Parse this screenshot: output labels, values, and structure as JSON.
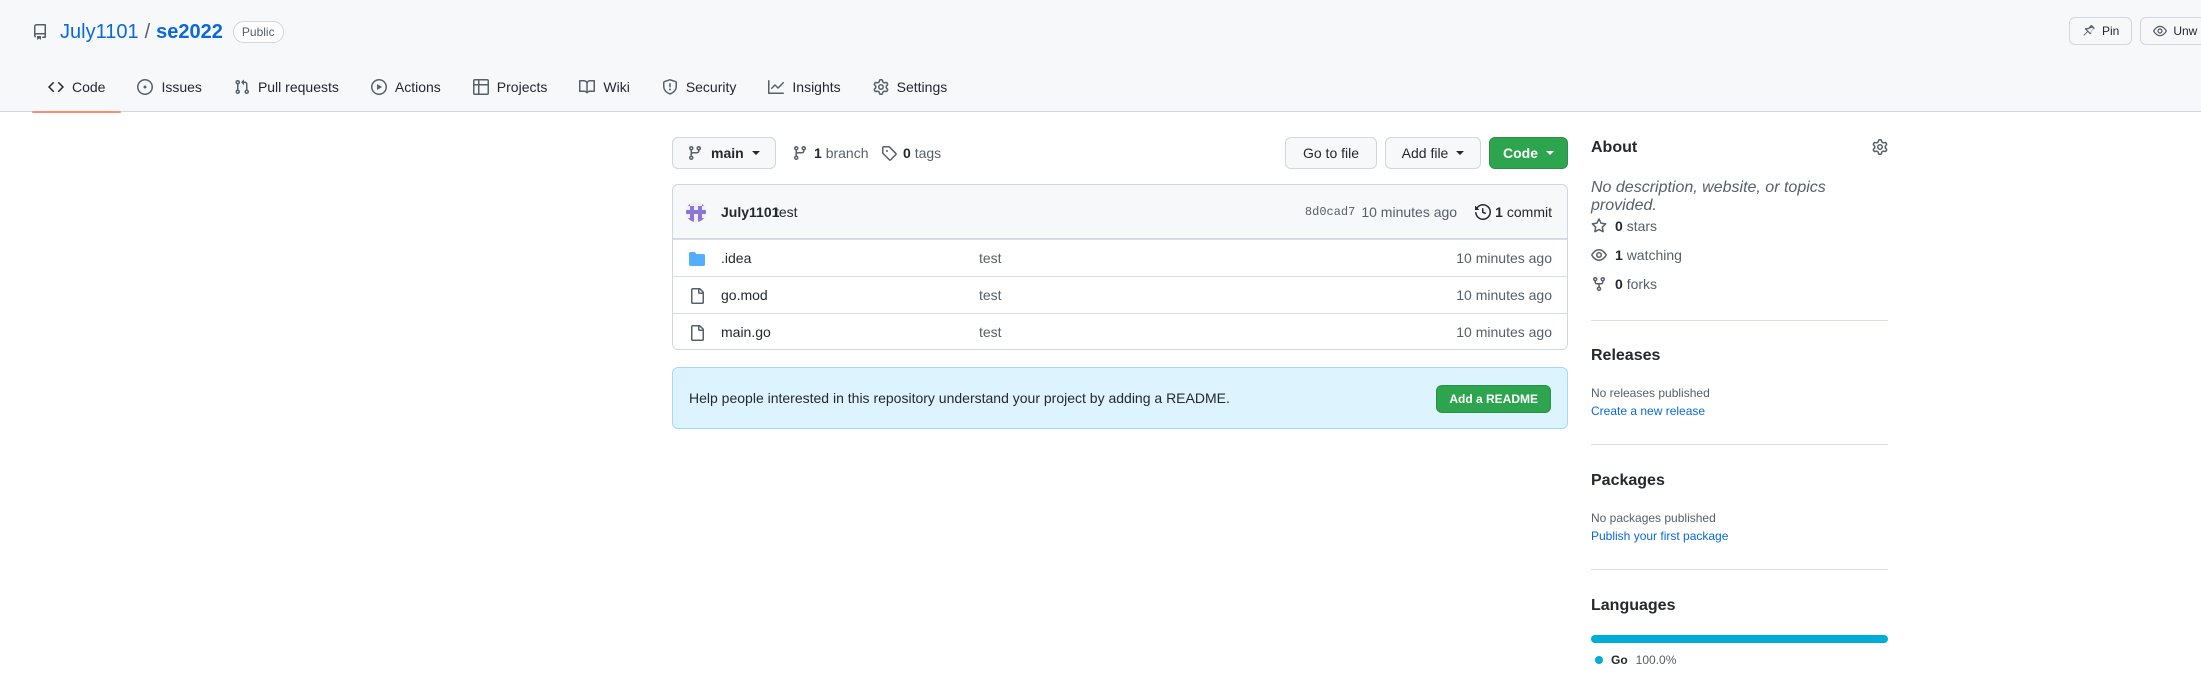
{
  "header": {
    "owner": "July1101",
    "separator": "/",
    "repo": "se2022",
    "visibility": "Public",
    "actions": [
      {
        "label": "Pin",
        "icon": "pin-icon"
      },
      {
        "label": "Unw",
        "icon": "eye-icon"
      }
    ]
  },
  "tabs": [
    {
      "label": "Code",
      "icon": "code-icon",
      "active": true
    },
    {
      "label": "Issues",
      "icon": "issue-icon"
    },
    {
      "label": "Pull requests",
      "icon": "pull-request-icon"
    },
    {
      "label": "Actions",
      "icon": "play-icon"
    },
    {
      "label": "Projects",
      "icon": "table-icon"
    },
    {
      "label": "Wiki",
      "icon": "book-icon"
    },
    {
      "label": "Security",
      "icon": "shield-icon"
    },
    {
      "label": "Insights",
      "icon": "graph-icon"
    },
    {
      "label": "Settings",
      "icon": "gear-icon"
    }
  ],
  "toolbar": {
    "branch": "main",
    "branch_count": "1",
    "branch_label": "branch",
    "tag_count": "0",
    "tag_label": "tags",
    "go_to_file": "Go to file",
    "add_file": "Add file",
    "code": "Code"
  },
  "commit": {
    "author": "July1101",
    "message": "test",
    "sha": "8d0cad7",
    "age": "10 minutes ago",
    "count": "1",
    "count_label": "commit"
  },
  "files": [
    {
      "name": ".idea",
      "type": "folder",
      "message": "test",
      "age": "10 minutes ago"
    },
    {
      "name": "go.mod",
      "type": "file",
      "message": "test",
      "age": "10 minutes ago"
    },
    {
      "name": "main.go",
      "type": "file",
      "message": "test",
      "age": "10 minutes ago"
    }
  ],
  "readme": {
    "message": "Help people interested in this repository understand your project by adding a README.",
    "button": "Add a README"
  },
  "about": {
    "title": "About",
    "description": "No description, website, or topics provided.",
    "stars_count": "0",
    "stars_label": "stars",
    "watching_count": "1",
    "watching_label": "watching",
    "forks_count": "0",
    "forks_label": "forks"
  },
  "releases": {
    "title": "Releases",
    "empty": "No releases published",
    "link": "Create a new release"
  },
  "packages": {
    "title": "Packages",
    "empty": "No packages published",
    "link": "Publish your first package"
  },
  "languages": {
    "title": "Languages",
    "items": [
      {
        "name": "Go",
        "percent": "100.0%",
        "share": 1.0,
        "color": "#00add8"
      }
    ]
  },
  "colors": {
    "link": "#0969da",
    "green": "#2da44e",
    "active_tab_underline": "#fd8c73",
    "readme_bg": "#ddf4ff",
    "folder": "#54aeff"
  }
}
